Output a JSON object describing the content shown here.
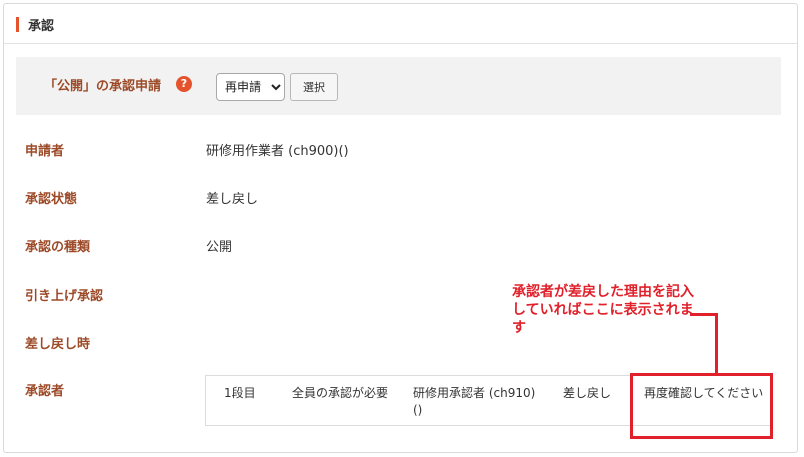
{
  "panel": {
    "title": "承認"
  },
  "request": {
    "label": "「公開」の承認申請",
    "help_icon": "?",
    "select_value": "再申請",
    "select_options": [
      "再申請"
    ],
    "select_button": "選択"
  },
  "fields": {
    "applicant_label": "申請者",
    "applicant_value": "研修用作業者 (ch900)()",
    "status_label": "承認状態",
    "status_value": "差し戻し",
    "type_label": "承認の種類",
    "type_value": "公開",
    "pullup_label": "引き上げ承認",
    "returned_label": "差し戻し時",
    "approver_label": "承認者"
  },
  "approver_row": {
    "step": "1段目",
    "rule": "全員の承認が必要",
    "approver": "研修用承認者 (ch910)()",
    "result": "差し戻し",
    "comment": "再度確認してください"
  },
  "annotation": {
    "text": "承認者が差戻した理由を記入していればここに表示されます"
  },
  "colors": {
    "accent": "#e5532d",
    "label": "#9c4a28",
    "annotation": "#e0202b"
  }
}
